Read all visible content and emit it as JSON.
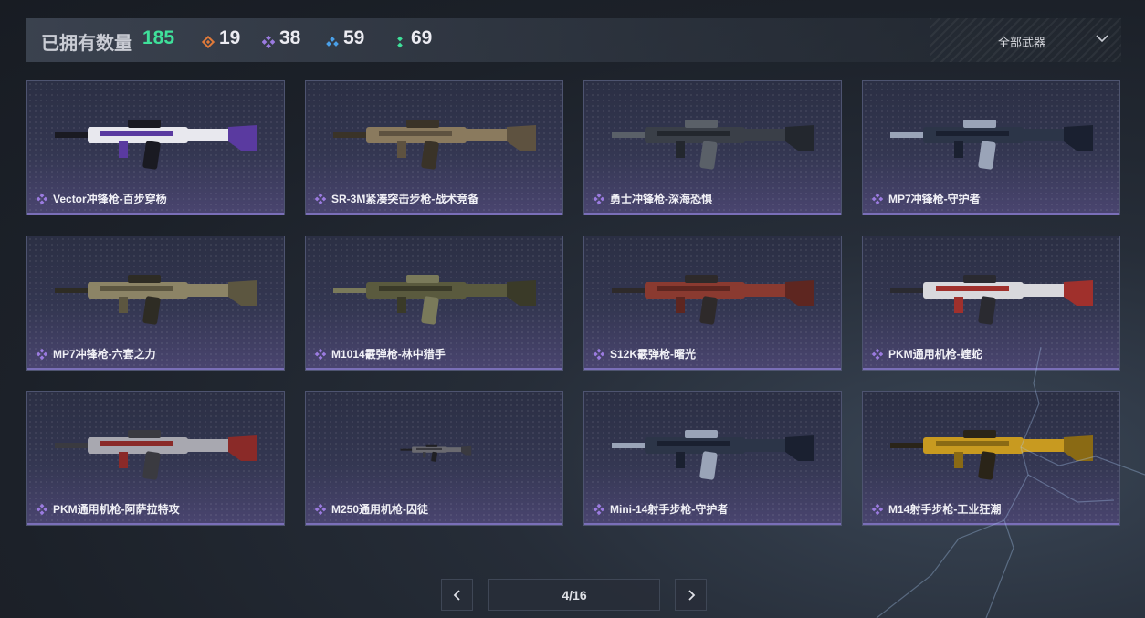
{
  "header": {
    "owned_label": "已拥有数量",
    "owned_count": "185",
    "stats": [
      {
        "icon": "orange-diamond-rarity-icon",
        "color": "#e07a3a",
        "value": "19"
      },
      {
        "icon": "purple-diamond-rarity-icon",
        "color": "#9b7be0",
        "value": "38"
      },
      {
        "icon": "blue-triangle-rarity-icon",
        "color": "#4aa0e8",
        "value": "59"
      },
      {
        "icon": "green-dots-rarity-icon",
        "color": "#3fe09a",
        "value": "69"
      }
    ],
    "filter_label": "全部武器"
  },
  "weapons": [
    {
      "name": "Vector冲锋枪-百步穿杨",
      "rarity_color": "#9b7be0",
      "skin": "white-purple"
    },
    {
      "name": "SR-3M紧凑突击步枪-战术竞备",
      "rarity_color": "#9b7be0",
      "skin": "tan"
    },
    {
      "name": "勇士冲锋枪-深海恐惧",
      "rarity_color": "#9b7be0",
      "skin": "dark"
    },
    {
      "name": "MP7冲锋枪-守护者",
      "rarity_color": "#9b7be0",
      "skin": "navy"
    },
    {
      "name": "MP7冲锋枪-六套之力",
      "rarity_color": "#9b7be0",
      "skin": "olive"
    },
    {
      "name": "M1014霰弹枪-林中猎手",
      "rarity_color": "#9b7be0",
      "skin": "camo"
    },
    {
      "name": "S12K霰弹枪-曙光",
      "rarity_color": "#9b7be0",
      "skin": "red"
    },
    {
      "name": "PKM通用机枪-蝰蛇",
      "rarity_color": "#9b7be0",
      "skin": "white-red"
    },
    {
      "name": "PKM通用机枪-阿萨拉特攻",
      "rarity_color": "#9b7be0",
      "skin": "silver-red"
    },
    {
      "name": "M250通用机枪-囚徒",
      "rarity_color": "#9b7be0",
      "skin": "small-dark"
    },
    {
      "name": "Mini-14射手步枪-守护者",
      "rarity_color": "#9b7be0",
      "skin": "navy"
    },
    {
      "name": "M14射手步枪-工业狂潮",
      "rarity_color": "#9b7be0",
      "skin": "gold"
    }
  ],
  "pagination": {
    "indicator": "4/16",
    "prev_icon": "chevron-left-icon",
    "next_icon": "chevron-right-icon"
  }
}
